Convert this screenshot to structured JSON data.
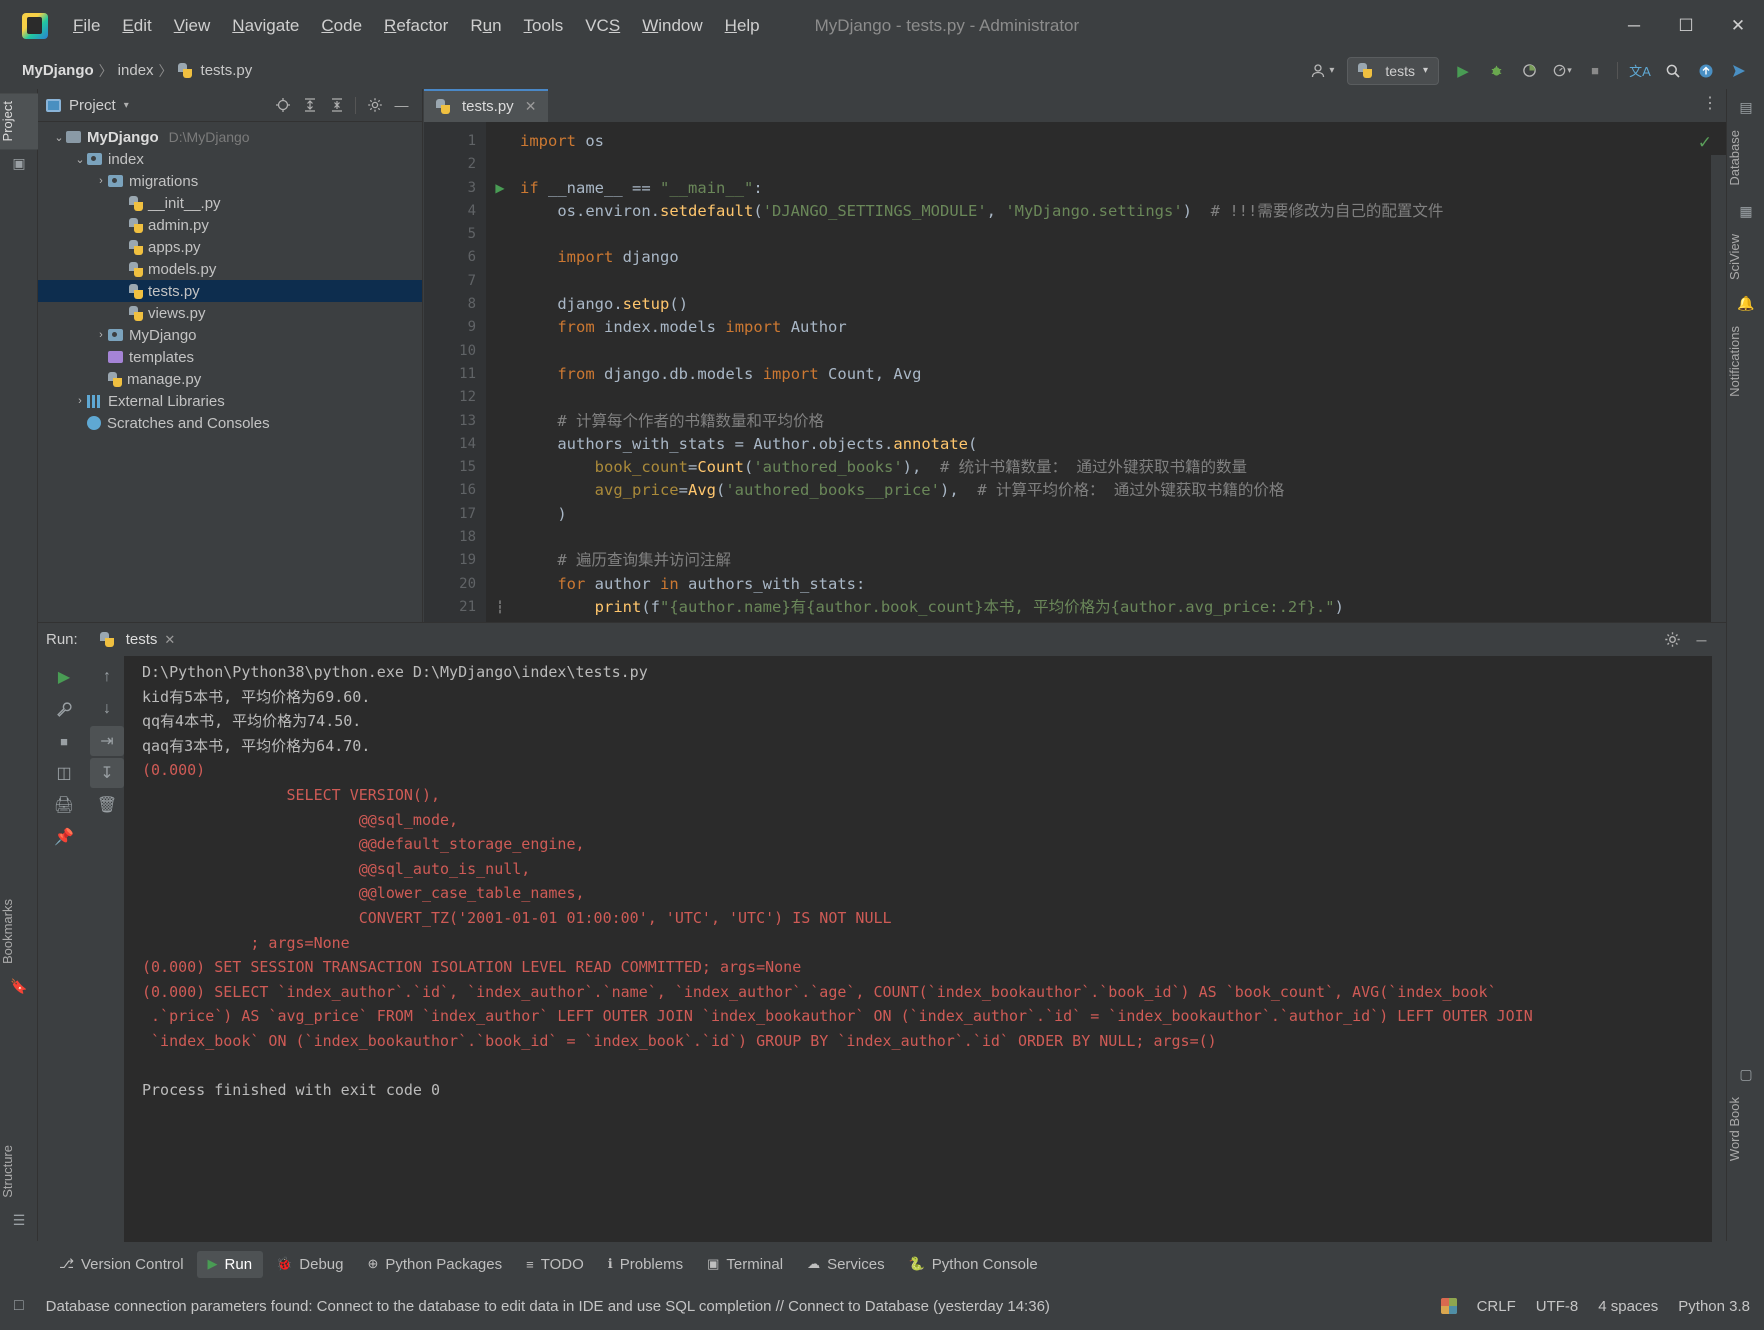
{
  "titlebar": {
    "window_title": "MyDjango - tests.py - Administrator",
    "logo_name": "pycharm-logo",
    "menu": [
      "File",
      "Edit",
      "View",
      "Navigate",
      "Code",
      "Refactor",
      "Run",
      "Tools",
      "VCS",
      "Window",
      "Help"
    ],
    "minimize": "─",
    "maximize": "☐",
    "close": "✕"
  },
  "navbar": {
    "crumbs": [
      "MyDjango",
      "index",
      "tests.py"
    ],
    "separator": "〉",
    "run_config": "tests",
    "run_config_caret": "▾",
    "icons": {
      "user": "●",
      "run": "▶",
      "debug": "🐞",
      "coverage": "◷",
      "profile": "◔",
      "stop": "■",
      "translate": "文A",
      "search": "⌕",
      "update": "↑",
      "share": "➤"
    }
  },
  "leftbar": {
    "project_tab": "Project",
    "bookmarks_tab": "Bookmarks",
    "structure_tab": "Structure"
  },
  "rightbar": {
    "database_tab": "Database",
    "sciview_tab": "SciView",
    "notifications_tab": "Notifications",
    "wordbook_tab": "Word Book"
  },
  "project_panel": {
    "title": "Project",
    "caret": "▾",
    "header_icons": [
      "locate-icon",
      "expand-all-icon",
      "collapse-all-icon",
      "settings-icon",
      "hide-icon"
    ],
    "tree": [
      {
        "label": "MyDjango",
        "path": "D:\\MyDjango",
        "indent": 0,
        "arrow": "⌄",
        "icon": "folder",
        "bold": true,
        "selected": false
      },
      {
        "label": "index",
        "path": "",
        "indent": 1,
        "arrow": "⌄",
        "icon": "folder-src",
        "bold": false,
        "selected": false
      },
      {
        "label": "migrations",
        "path": "",
        "indent": 2,
        "arrow": "›",
        "icon": "folder-src",
        "bold": false,
        "selected": false
      },
      {
        "label": "__init__.py",
        "path": "",
        "indent": 3,
        "arrow": "",
        "icon": "python",
        "bold": false,
        "selected": false
      },
      {
        "label": "admin.py",
        "path": "",
        "indent": 3,
        "arrow": "",
        "icon": "python",
        "bold": false,
        "selected": false
      },
      {
        "label": "apps.py",
        "path": "",
        "indent": 3,
        "arrow": "",
        "icon": "python",
        "bold": false,
        "selected": false
      },
      {
        "label": "models.py",
        "path": "",
        "indent": 3,
        "arrow": "",
        "icon": "python",
        "bold": false,
        "selected": false
      },
      {
        "label": "tests.py",
        "path": "",
        "indent": 3,
        "arrow": "",
        "icon": "python",
        "bold": false,
        "selected": true
      },
      {
        "label": "views.py",
        "path": "",
        "indent": 3,
        "arrow": "",
        "icon": "python",
        "bold": false,
        "selected": false
      },
      {
        "label": "MyDjango",
        "path": "",
        "indent": 2,
        "arrow": "›",
        "icon": "folder-src",
        "bold": false,
        "selected": false
      },
      {
        "label": "templates",
        "path": "",
        "indent": 2,
        "arrow": "",
        "icon": "folder-tpl",
        "bold": false,
        "selected": false
      },
      {
        "label": "manage.py",
        "path": "",
        "indent": 2,
        "arrow": "",
        "icon": "python",
        "bold": false,
        "selected": false
      },
      {
        "label": "External Libraries",
        "path": "",
        "indent": 1,
        "arrow": "›",
        "icon": "library",
        "bold": false,
        "selected": false
      },
      {
        "label": "Scratches and Consoles",
        "path": "",
        "indent": 1,
        "arrow": "",
        "icon": "scratch",
        "bold": false,
        "selected": false
      }
    ]
  },
  "editor": {
    "tab_label": "tests.py",
    "tab_close": "✕",
    "more_icon": "⋮",
    "inspection_ok": "✓",
    "line_numbers": [
      1,
      2,
      3,
      4,
      5,
      6,
      7,
      8,
      9,
      10,
      11,
      12,
      13,
      14,
      15,
      16,
      17,
      18,
      19,
      20,
      21
    ],
    "lines": [
      "import os",
      "",
      "if __name__ == \"__main__\":",
      "    os.environ.setdefault('DJANGO_SETTINGS_MODULE', 'MyDjango.settings')  # !!!需要修改为自己的配置文件",
      "",
      "    import django",
      "",
      "    django.setup()",
      "    from index.models import Author",
      "",
      "    from django.db.models import Count, Avg",
      "",
      "    # 计算每个作者的书籍数量和平均价格",
      "    authors_with_stats = Author.objects.annotate(",
      "        book_count=Count('authored_books'),  # 统计书籍数量： 通过外键获取书籍的数量",
      "        avg_price=Avg('authored_books__price'),  # 计算平均价格： 通过外键获取书籍的价格",
      "    )",
      "",
      "    # 遍历查询集并访问注解",
      "    for author in authors_with_stats:",
      "        print(f\"{author.name}有{author.book_count}本书, 平均价格为{author.avg_price:.2f}.\")"
    ]
  },
  "run_panel": {
    "label": "Run:",
    "tab_name": "tests",
    "tab_close": "✕",
    "settings_icon": "⚙",
    "minimize_icon": "─",
    "side_icons": [
      "rerun-icon",
      "wrench-icon",
      "stop-icon",
      "layout-icon",
      "print-icon",
      "pin-icon",
      "trash-icon",
      "scroll-up-icon",
      "scroll-down-icon",
      "soft-wrap-icon",
      "scroll-end-icon"
    ],
    "console_lines": [
      {
        "text": "D:\\Python\\Python38\\python.exe D:\\MyDjango\\index\\tests.py",
        "color": "normal"
      },
      {
        "text": "kid有5本书, 平均价格为69.60.",
        "color": "normal"
      },
      {
        "text": "qq有4本书, 平均价格为74.50.",
        "color": "normal"
      },
      {
        "text": "qaq有3本书, 平均价格为64.70.",
        "color": "normal"
      },
      {
        "text": "(0.000)",
        "color": "red"
      },
      {
        "text": "                SELECT VERSION(),",
        "color": "red"
      },
      {
        "text": "                        @@sql_mode,",
        "color": "red"
      },
      {
        "text": "                        @@default_storage_engine,",
        "color": "red"
      },
      {
        "text": "                        @@sql_auto_is_null,",
        "color": "red"
      },
      {
        "text": "                        @@lower_case_table_names,",
        "color": "red"
      },
      {
        "text": "                        CONVERT_TZ('2001-01-01 01:00:00', 'UTC', 'UTC') IS NOT NULL",
        "color": "red"
      },
      {
        "text": "            ; args=None",
        "color": "red"
      },
      {
        "text": "(0.000) SET SESSION TRANSACTION ISOLATION LEVEL READ COMMITTED; args=None",
        "color": "red"
      },
      {
        "text": "(0.000) SELECT `index_author`.`id`, `index_author`.`name`, `index_author`.`age`, COUNT(`index_bookauthor`.`book_id`) AS `book_count`, AVG(`index_book`",
        "color": "red"
      },
      {
        "text": " .`price`) AS `avg_price` FROM `index_author` LEFT OUTER JOIN `index_bookauthor` ON (`index_author`.`id` = `index_bookauthor`.`author_id`) LEFT OUTER JOIN",
        "color": "red"
      },
      {
        "text": " `index_book` ON (`index_bookauthor`.`book_id` = `index_book`.`id`) GROUP BY `index_author`.`id` ORDER BY NULL; args=()",
        "color": "red"
      },
      {
        "text": "",
        "color": "normal"
      },
      {
        "text": "Process finished with exit code 0",
        "color": "normal"
      }
    ]
  },
  "bottom_tabs": [
    {
      "label": "Version Control",
      "icon": "⎇",
      "active": false
    },
    {
      "label": "Run",
      "icon": "▶",
      "active": true
    },
    {
      "label": "Debug",
      "icon": "🐞",
      "active": false
    },
    {
      "label": "Python Packages",
      "icon": "⊕",
      "active": false
    },
    {
      "label": "TODO",
      "icon": "≡",
      "active": false
    },
    {
      "label": "Problems",
      "icon": "ℹ",
      "active": false
    },
    {
      "label": "Terminal",
      "icon": "▣",
      "active": false
    },
    {
      "label": "Services",
      "icon": "☁",
      "active": false
    },
    {
      "label": "Python Console",
      "icon": "🐍",
      "active": false
    }
  ],
  "statusbar": {
    "message": "Database connection parameters found: Connect to the database to edit data in IDE and use SQL completion // Connect to Database (yesterday 14:36)",
    "line_sep": "CRLF",
    "encoding": "UTF-8",
    "indent": "4 spaces",
    "interpreter": "Python 3.8",
    "event_icon": "□"
  },
  "colors": {
    "accent": "#4a88c7",
    "selection": "#0d2d4e",
    "editor_bg": "#2b2b2b",
    "panel_bg": "#3c3f41",
    "error_red": "#cf5b56",
    "keyword_orange": "#cc7832",
    "string_green": "#6a8759"
  }
}
